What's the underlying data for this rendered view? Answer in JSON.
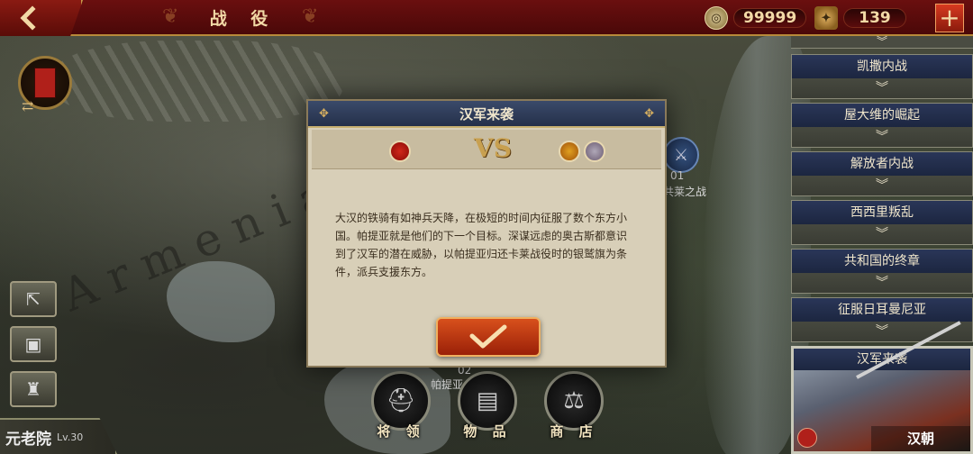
{
  "header": {
    "title": "战 役",
    "coins": "99999",
    "medals": "139"
  },
  "map": {
    "region_label": "Armenia",
    "marker_01_number": "01",
    "marker_01_label": "共莱之战",
    "marker_02_number": "02",
    "marker_02_label": "帕提亚"
  },
  "left_panel": {
    "senate_label": "元老院",
    "senate_level": "Lv.30"
  },
  "bottom_nav": [
    {
      "label": "将 领"
    },
    {
      "label": "物 品"
    },
    {
      "label": "商 店"
    }
  ],
  "campaigns": [
    {
      "title": "凯撒内战"
    },
    {
      "title": "屋大维的崛起"
    },
    {
      "title": "解放者内战"
    },
    {
      "title": "西西里叛乱"
    },
    {
      "title": "共和国的终章"
    },
    {
      "title": "征服日耳曼尼亚"
    }
  ],
  "selected_campaign": {
    "title": "汉军来袭",
    "faction": "汉朝"
  },
  "dialog": {
    "title": "汉军来袭",
    "vs": "VS",
    "body": "大汉的铁骑有如神兵天降，在极短的时间内征服了数个东方小国。帕提亚就是他们的下一个目标。深谋远虑的奥古斯都意识到了汉军的潜在威胁，以帕提亚归还卡莱战役时的银鹫旗为条件，派兵支援东方。"
  },
  "colors": {
    "topbar": "#5a0c0c",
    "accent_gold": "#f2d9a6",
    "dialog_bg": "#d8cfb8",
    "confirm": "#c8401a",
    "campaign_title_bg": "#25304a"
  },
  "icons": {
    "back": "back-arrow-icon",
    "coin": "coin-icon",
    "medal": "medal-icon",
    "add": "plus-icon",
    "confirm": "checkmark-icon"
  }
}
